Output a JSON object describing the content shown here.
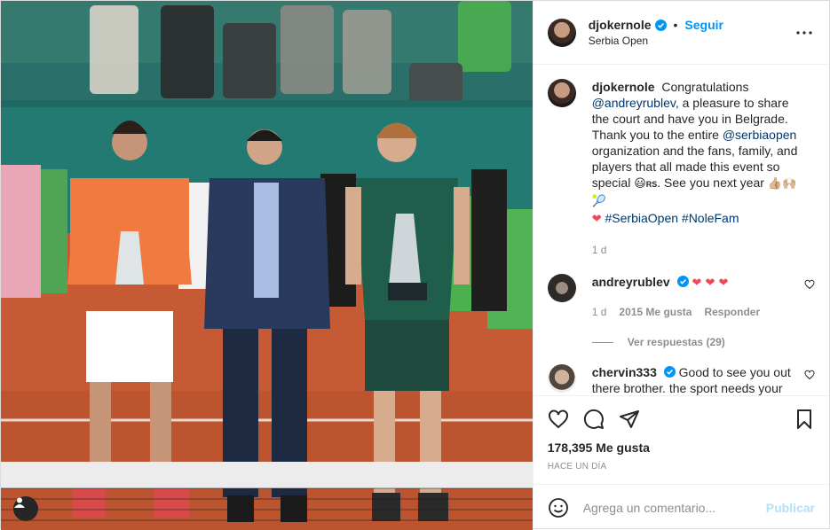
{
  "header": {
    "username": "djokernole",
    "separator": "•",
    "follow_label": "Seguir",
    "location": "Serbia Open"
  },
  "caption": {
    "username": "djokernole",
    "parts": {
      "p1": "Congratulations ",
      "m1": "@andreyrublev",
      "p2": ", a pleasure to share the court and have you in Belgrade. Thank you to the entire ",
      "m2": "@serbiaopen",
      "p3": " organization and the fans, family, and players that all made this event so special ",
      "e1": "😃",
      "e1b": "RS",
      "p4": ". See you next year ",
      "e2": "👍🏼🙌🏼🎾",
      "e3": "❤",
      "tags": "#SerbiaOpen #NoleFam"
    },
    "time": "1 d"
  },
  "comments": [
    {
      "username": "andreyrublev",
      "text": "❤ ❤ ❤",
      "time": "1 d",
      "likes": "2015 Me gusta",
      "reply_label": "Responder",
      "replies_label": "Ver respuestas (29)"
    },
    {
      "username": "chervin333",
      "text": "Good to see you out there brother. the sport needs your"
    }
  ],
  "icons": {
    "verified": "verified-badge-icon",
    "more": "more-options-icon",
    "like": "heart-icon",
    "comment": "comment-icon",
    "share": "paper-plane-icon",
    "save": "bookmark-icon",
    "emoji": "emoji-icon",
    "user_tag": "user-tag-icon"
  },
  "likes": "178,395 Me gusta",
  "timestamp": "HACE UN DÍA",
  "add_comment": {
    "placeholder": "Agrega un comentario...",
    "post_label": "Publicar"
  },
  "colors": {
    "accent": "#0095f6",
    "link": "#00376b",
    "muted": "#8e8e8e",
    "heart": "#ed4956",
    "post_disabled": "#b2dffc"
  }
}
